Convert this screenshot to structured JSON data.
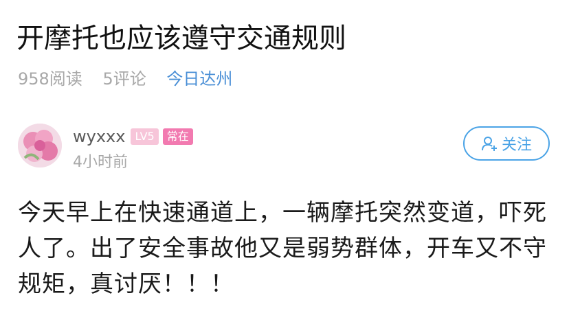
{
  "article": {
    "title": "开摩托也应该遵守交通规则",
    "reads": "958阅读",
    "comments": "5评论",
    "source": "今日达州"
  },
  "author": {
    "username": "wyxxx",
    "level_badge": "LV5",
    "status_badge": "常在",
    "post_time": "4小时前",
    "follow_label": "关注"
  },
  "post": {
    "body": "今天早上在快速通道上，一辆摩托突然变道，吓死人了。出了安全事故他又是弱势群体，开车又不守规矩，真讨厌！！！"
  },
  "colors": {
    "accent": "#4aa3e6",
    "source_link": "#4a8fd6",
    "badge_pink": "#f27ab0",
    "muted": "#a8a8a8"
  },
  "icons": {
    "follow": "add-user-icon",
    "avatar": "pink-carnation-avatar"
  }
}
